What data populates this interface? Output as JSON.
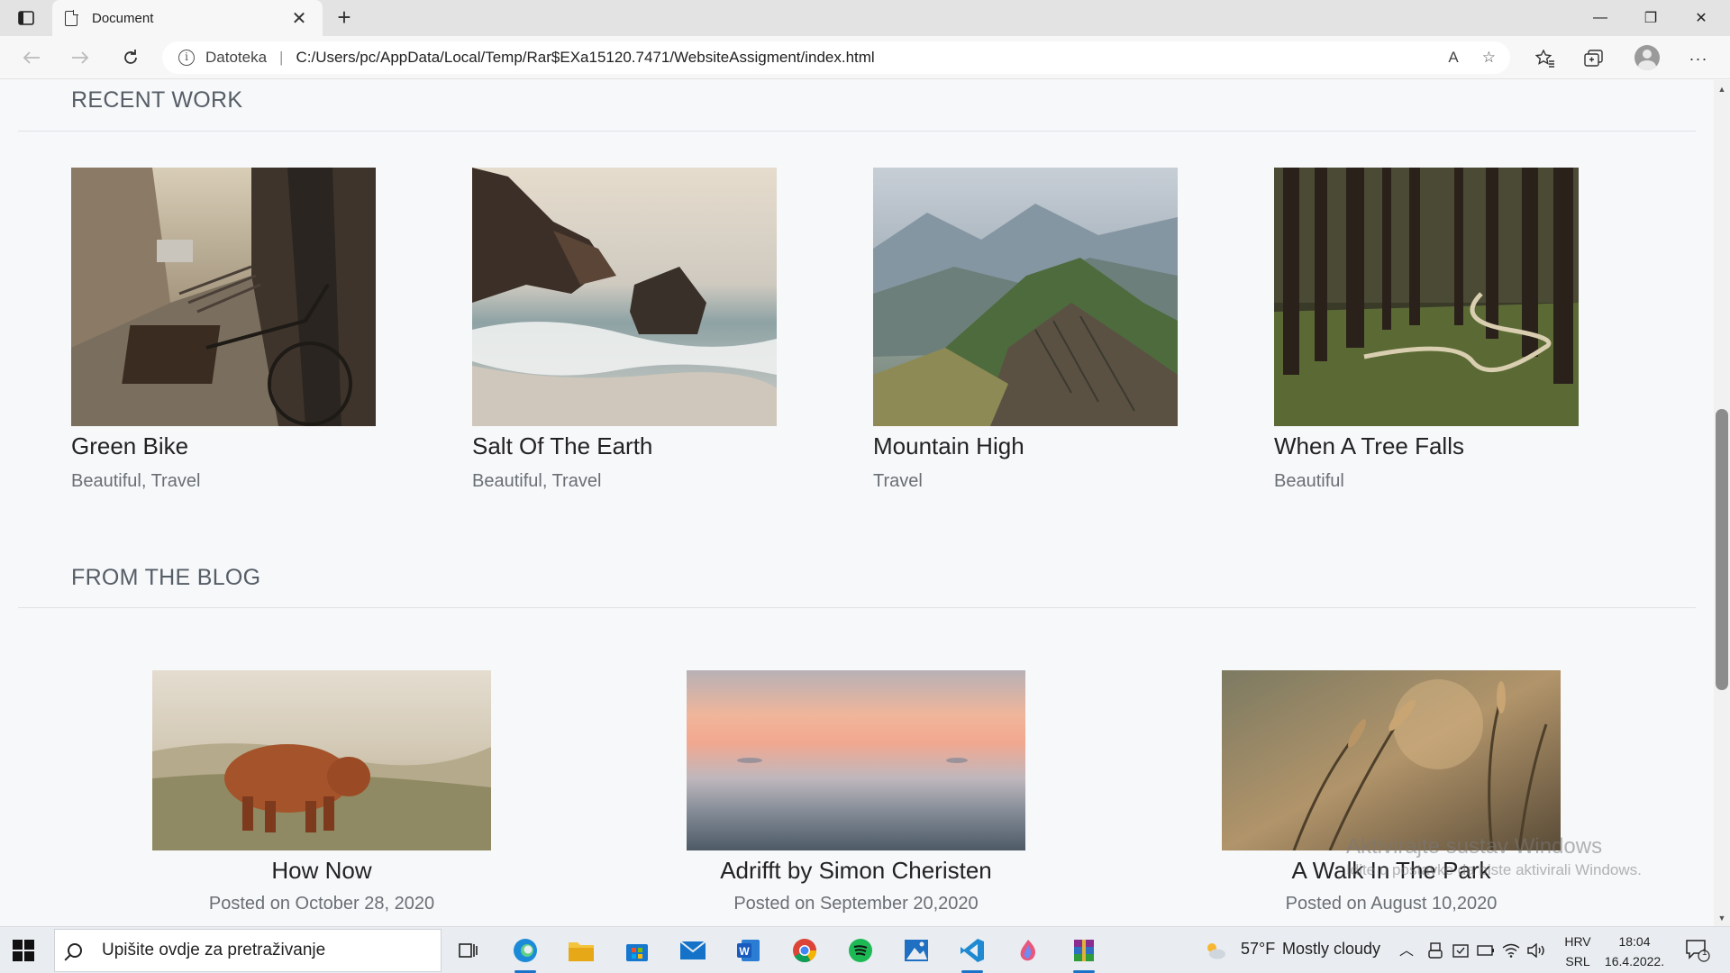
{
  "browser": {
    "tab_title": "Document",
    "tab_close": "✕",
    "new_tab": "+",
    "url_prefix": "Datoteka",
    "url_separator": "|",
    "url": "C:/Users/pc/AppData/Local/Temp/Rar$EXa15120.7471/WebsiteAssigment/index.html",
    "read_aloud": "A",
    "window_controls": {
      "minimize": "—",
      "restore": "❐",
      "close": "✕"
    },
    "toolbar_more": "···"
  },
  "sections": {
    "recent_work_heading": "RECENT WORK",
    "blog_heading": "FROM THE BLOG"
  },
  "works": [
    {
      "title": "Green Bike",
      "tags": "Beautiful, Travel",
      "image": "street-bike-photo"
    },
    {
      "title": "Salt Of The Earth",
      "tags": "Beautiful, Travel",
      "image": "sea-rocks-photo"
    },
    {
      "title": "Mountain High",
      "tags": "Travel",
      "image": "mountain-photo"
    },
    {
      "title": "When A Tree Falls",
      "tags": "Beautiful",
      "image": "forest-path-photo"
    }
  ],
  "blog_posts": [
    {
      "title": "How Now",
      "date": "Posted on October 28, 2020",
      "image": "highland-cow-photo"
    },
    {
      "title": "Adrifft by Simon Cheristen",
      "date": "Posted on September 20,2020",
      "image": "misty-sea-photo"
    },
    {
      "title": "A Walk In The Park",
      "date": "Posted on August 10,2020",
      "image": "wheat-field-photo"
    }
  ],
  "watermark": {
    "line1": "Aktivirajte sustav Windows",
    "line2": "Idite u postavke da biste aktivirali Windows."
  },
  "taskbar": {
    "search_placeholder": "Upišite ovdje za pretraživanje",
    "weather_temp": "57°F",
    "weather_text": "Mostly cloudy",
    "lang_1": "HRV",
    "lang_2": "SRL",
    "time": "18:04",
    "date": "16.4.2022.",
    "notification_count": "1"
  },
  "colors": {
    "accent": "#1a73c8",
    "heading": "#555d66",
    "muted": "#6a6f75"
  }
}
